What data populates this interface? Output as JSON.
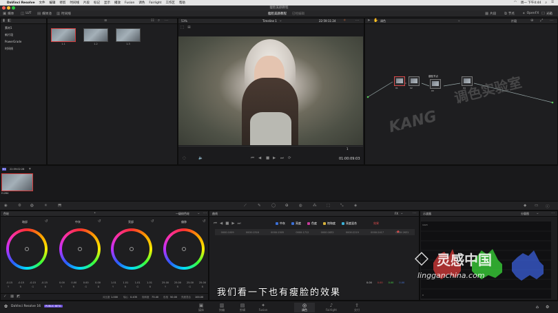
{
  "menubar": {
    "app": "DaVinci Resolve",
    "items": [
      "文件",
      "编辑",
      "修剪",
      "时间线",
      "片段",
      "标记",
      "显示",
      "播放",
      "Fusion",
      "调色",
      "Fairlight",
      "工作区",
      "帮助"
    ],
    "clock": "周一 下午4:44"
  },
  "window_title": "瘦脸美颜教程",
  "toolbar": {
    "left": [
      "媒体",
      "LUT",
      "媒体池",
      "时间线"
    ],
    "project_title": "瘦脸美颜教程",
    "project_status": "已经编辑",
    "right": [
      "片段",
      "节点",
      "OpenFX",
      "光箱"
    ]
  },
  "media_pool": {
    "items": [
      "素材1",
      "新片段",
      "PowerGrade",
      "时间线"
    ],
    "clips": [
      {
        "label": "1.1",
        "selected": true
      },
      {
        "label": "1.2",
        "selected": false
      },
      {
        "label": "1.3",
        "selected": false
      }
    ]
  },
  "viewer": {
    "zoom": "53%",
    "timeline": "Timeline 1",
    "timecode_top": "22:59:11:24",
    "timecode_bottom": "01:00:09:03",
    "clip_marker": "1"
  },
  "node_editor": {
    "mode": "调色",
    "mode_right": "片段",
    "nodes": [
      {
        "label": "01"
      },
      {
        "label": "02"
      },
      {
        "label": "03",
        "title": "瘦脸节点"
      },
      {
        "label": "04"
      }
    ]
  },
  "timeline_strip": {
    "clip_id": "01",
    "timecode": "22:59:02:28",
    "clip_codec": "H.264"
  },
  "color_wheels": {
    "panel_title": "色轮",
    "mode": "一级校色轮",
    "wheels": [
      {
        "name": "暗部",
        "values": [
          "-0.15",
          "-0.15",
          "-0.15",
          "-0.15"
        ]
      },
      {
        "name": "中灰",
        "values": [
          "0.00",
          "0.00",
          "0.00",
          "0.00"
        ]
      },
      {
        "name": "亮部",
        "values": [
          "1.01",
          "1.01",
          "1.01",
          "1.01"
        ]
      },
      {
        "name": "偏移",
        "values": [
          "25.00",
          "25.00",
          "25.00",
          "25.00"
        ]
      }
    ],
    "channel_labels": [
      "Y",
      "R",
      "G",
      "B"
    ],
    "footer": [
      {
        "label": "对比度",
        "value": "1.000"
      },
      {
        "label": "轴心",
        "value": "0.435"
      },
      {
        "label": "饱和度",
        "value": "73.40"
      },
      {
        "label": "色相",
        "value": "50.00"
      },
      {
        "label": "亮度混合",
        "value": "100.00"
      }
    ]
  },
  "curves": {
    "title": "曲线",
    "channels": [
      "中灰",
      "亮度",
      "色度",
      "饱和度",
      "亮度混合"
    ],
    "tag": "效果",
    "fx_label": "FX",
    "readouts": [
      "0000:1009",
      "0000:1316",
      "0000:1505",
      "0000:1712",
      "0000:1832",
      "0000:2219",
      "0000:2417",
      "0000:2631"
    ],
    "values": [
      "0.00",
      "0.00",
      "0.00",
      "0.00"
    ]
  },
  "scopes": {
    "title": "示波器",
    "mode": "分量图"
  },
  "subtitle": "我们看一下也有瘦脸的效果",
  "watermark": {
    "brand": "KANG",
    "text": "调色实验室",
    "site_cn": "灵感中国",
    "site_url": "lingganchina.com"
  },
  "bottom": {
    "app": "DaVinci Resolve 16",
    "badge": "PUBLIC BETA",
    "pages": [
      "媒体",
      "快编",
      "剪辑",
      "Fusion",
      "调色",
      "Fairlight",
      "交付"
    ],
    "active_page": "调色"
  }
}
